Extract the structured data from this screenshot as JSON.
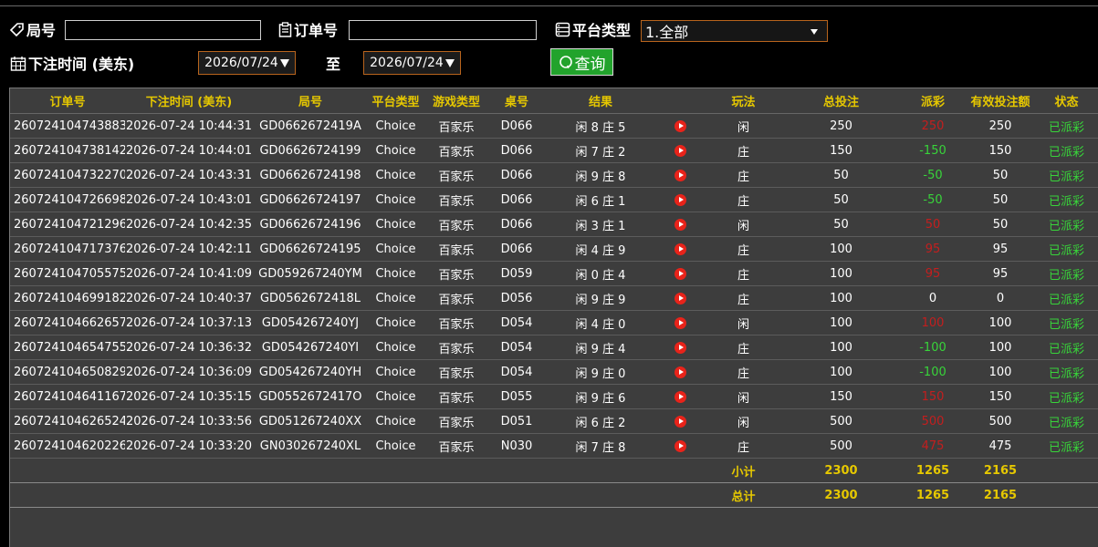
{
  "filters": {
    "round_label": "局号",
    "round_value": "",
    "order_label": "订单号",
    "order_value": "",
    "platform_label": "平台类型",
    "platform_selected": "1.全部",
    "bet_time_label": "下注时间 (美东)",
    "date_from": "2026/07/24",
    "to_label": "至",
    "date_to": "2026/07/24",
    "query_label": "查询"
  },
  "table": {
    "headers": [
      "订单号",
      "下注时间 (美东)",
      "局号",
      "平台类型",
      "游戏类型",
      "桌号",
      "结果",
      "",
      "玩法",
      "总投注",
      "派彩",
      "有效投注额",
      "状态"
    ],
    "rows": [
      {
        "order": "260724104743883",
        "time": "2026-07-24 10:44:31",
        "round": "GD0662672419A",
        "platform": "Choice",
        "game": "百家乐",
        "table": "D066",
        "result": "闲 8 庄 5",
        "play": "闲",
        "bet": "250",
        "payout": "250",
        "payout_color": "red",
        "valid": "250",
        "status": "已派彩"
      },
      {
        "order": "260724104738142",
        "time": "2026-07-24 10:44:01",
        "round": "GD06626724199",
        "platform": "Choice",
        "game": "百家乐",
        "table": "D066",
        "result": "闲 7 庄 2",
        "play": "庄",
        "bet": "150",
        "payout": "-150",
        "payout_color": "green",
        "valid": "150",
        "status": "已派彩"
      },
      {
        "order": "260724104732270",
        "time": "2026-07-24 10:43:31",
        "round": "GD06626724198",
        "platform": "Choice",
        "game": "百家乐",
        "table": "D066",
        "result": "闲 9 庄 8",
        "play": "庄",
        "bet": "50",
        "payout": "-50",
        "payout_color": "green",
        "valid": "50",
        "status": "已派彩"
      },
      {
        "order": "260724104726698",
        "time": "2026-07-24 10:43:01",
        "round": "GD06626724197",
        "platform": "Choice",
        "game": "百家乐",
        "table": "D066",
        "result": "闲 6 庄 1",
        "play": "庄",
        "bet": "50",
        "payout": "-50",
        "payout_color": "green",
        "valid": "50",
        "status": "已派彩"
      },
      {
        "order": "260724104721296",
        "time": "2026-07-24 10:42:35",
        "round": "GD06626724196",
        "platform": "Choice",
        "game": "百家乐",
        "table": "D066",
        "result": "闲 3 庄 1",
        "play": "闲",
        "bet": "50",
        "payout": "50",
        "payout_color": "red",
        "valid": "50",
        "status": "已派彩"
      },
      {
        "order": "260724104717376",
        "time": "2026-07-24 10:42:11",
        "round": "GD06626724195",
        "platform": "Choice",
        "game": "百家乐",
        "table": "D066",
        "result": "闲 4 庄 9",
        "play": "庄",
        "bet": "100",
        "payout": "95",
        "payout_color": "red",
        "valid": "95",
        "status": "已派彩"
      },
      {
        "order": "260724104705575",
        "time": "2026-07-24 10:41:09",
        "round": "GD059267240YM",
        "platform": "Choice",
        "game": "百家乐",
        "table": "D059",
        "result": "闲 0 庄 4",
        "play": "庄",
        "bet": "100",
        "payout": "95",
        "payout_color": "red",
        "valid": "95",
        "status": "已派彩"
      },
      {
        "order": "260724104699182",
        "time": "2026-07-24 10:40:37",
        "round": "GD0562672418L",
        "platform": "Choice",
        "game": "百家乐",
        "table": "D056",
        "result": "闲 9 庄 9",
        "play": "庄",
        "bet": "100",
        "payout": "0",
        "payout_color": "white",
        "valid": "0",
        "status": "已派彩"
      },
      {
        "order": "260724104662657",
        "time": "2026-07-24 10:37:13",
        "round": "GD054267240YJ",
        "platform": "Choice",
        "game": "百家乐",
        "table": "D054",
        "result": "闲 4 庄 0",
        "play": "闲",
        "bet": "100",
        "payout": "100",
        "payout_color": "red",
        "valid": "100",
        "status": "已派彩"
      },
      {
        "order": "260724104654755",
        "time": "2026-07-24 10:36:32",
        "round": "GD054267240YI",
        "platform": "Choice",
        "game": "百家乐",
        "table": "D054",
        "result": "闲 9 庄 4",
        "play": "庄",
        "bet": "100",
        "payout": "-100",
        "payout_color": "green",
        "valid": "100",
        "status": "已派彩"
      },
      {
        "order": "260724104650829",
        "time": "2026-07-24 10:36:09",
        "round": "GD054267240YH",
        "platform": "Choice",
        "game": "百家乐",
        "table": "D054",
        "result": "闲 9 庄 0",
        "play": "庄",
        "bet": "100",
        "payout": "-100",
        "payout_color": "green",
        "valid": "100",
        "status": "已派彩"
      },
      {
        "order": "260724104641167",
        "time": "2026-07-24 10:35:15",
        "round": "GD0552672417O",
        "platform": "Choice",
        "game": "百家乐",
        "table": "D055",
        "result": "闲 9 庄 6",
        "play": "闲",
        "bet": "150",
        "payout": "150",
        "payout_color": "red",
        "valid": "150",
        "status": "已派彩"
      },
      {
        "order": "260724104626524",
        "time": "2026-07-24 10:33:56",
        "round": "GD051267240XX",
        "platform": "Choice",
        "game": "百家乐",
        "table": "D051",
        "result": "闲 6 庄 2",
        "play": "闲",
        "bet": "500",
        "payout": "500",
        "payout_color": "red",
        "valid": "500",
        "status": "已派彩"
      },
      {
        "order": "260724104620226",
        "time": "2026-07-24 10:33:20",
        "round": "GN030267240XL",
        "platform": "Choice",
        "game": "百家乐",
        "table": "N030",
        "result": "闲 7 庄 8",
        "play": "庄",
        "bet": "500",
        "payout": "475",
        "payout_color": "red",
        "valid": "475",
        "status": "已派彩"
      }
    ],
    "subtotal": {
      "label": "小计",
      "bet": "2300",
      "payout": "1265",
      "valid": "2165"
    },
    "total": {
      "label": "总计",
      "bet": "2300",
      "payout": "1265",
      "valid": "2165"
    }
  },
  "icons": {
    "round": "tag-icon",
    "order": "clipboard-icon",
    "platform": "server-icon",
    "bet_time": "calendar-icon",
    "query": "search-icon",
    "replay": "play-icon"
  },
  "colors": {
    "header_text": "#e6c800",
    "loss_red": "#c41e1e",
    "win_green": "#38d43a",
    "accent_border": "#b8641d",
    "query_button": "#22a32c",
    "panel_bg": "#3d3d3d"
  }
}
